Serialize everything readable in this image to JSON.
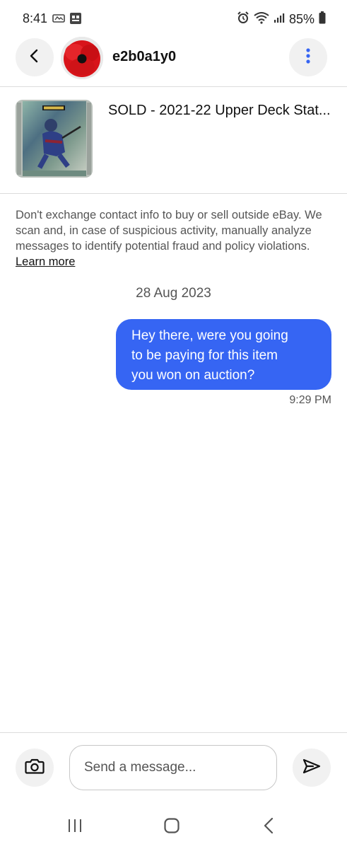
{
  "status_bar": {
    "time": "8:41",
    "battery": "85%"
  },
  "header": {
    "username": "e2b0a1y0"
  },
  "item": {
    "title": "SOLD - 2021-22 Upper Deck Stat..."
  },
  "notice": {
    "text": "Don't exchange contact info to buy or sell outside eBay. We scan and, in case of suspicious activity, manually analyze messages to identify potential fraud and policy violations.",
    "link_label": "Learn more"
  },
  "conversation": {
    "date": "28 Aug 2023",
    "messages": [
      {
        "text": "Hey there,  were you going\nto be paying for this item\nyou won on auction?",
        "time": "9:29 PM"
      }
    ]
  },
  "composer": {
    "placeholder": "Send a message..."
  },
  "colors": {
    "bubble": "#3665f3",
    "more_dots": "#3665f3",
    "button_bg": "#f1f1f1"
  },
  "icons": {
    "back": "back-arrow-icon",
    "more": "more-vertical-icon",
    "camera": "camera-icon",
    "send": "send-icon",
    "nav_recent": "recent-apps-icon",
    "nav_home": "home-icon",
    "nav_back": "nav-back-icon"
  }
}
